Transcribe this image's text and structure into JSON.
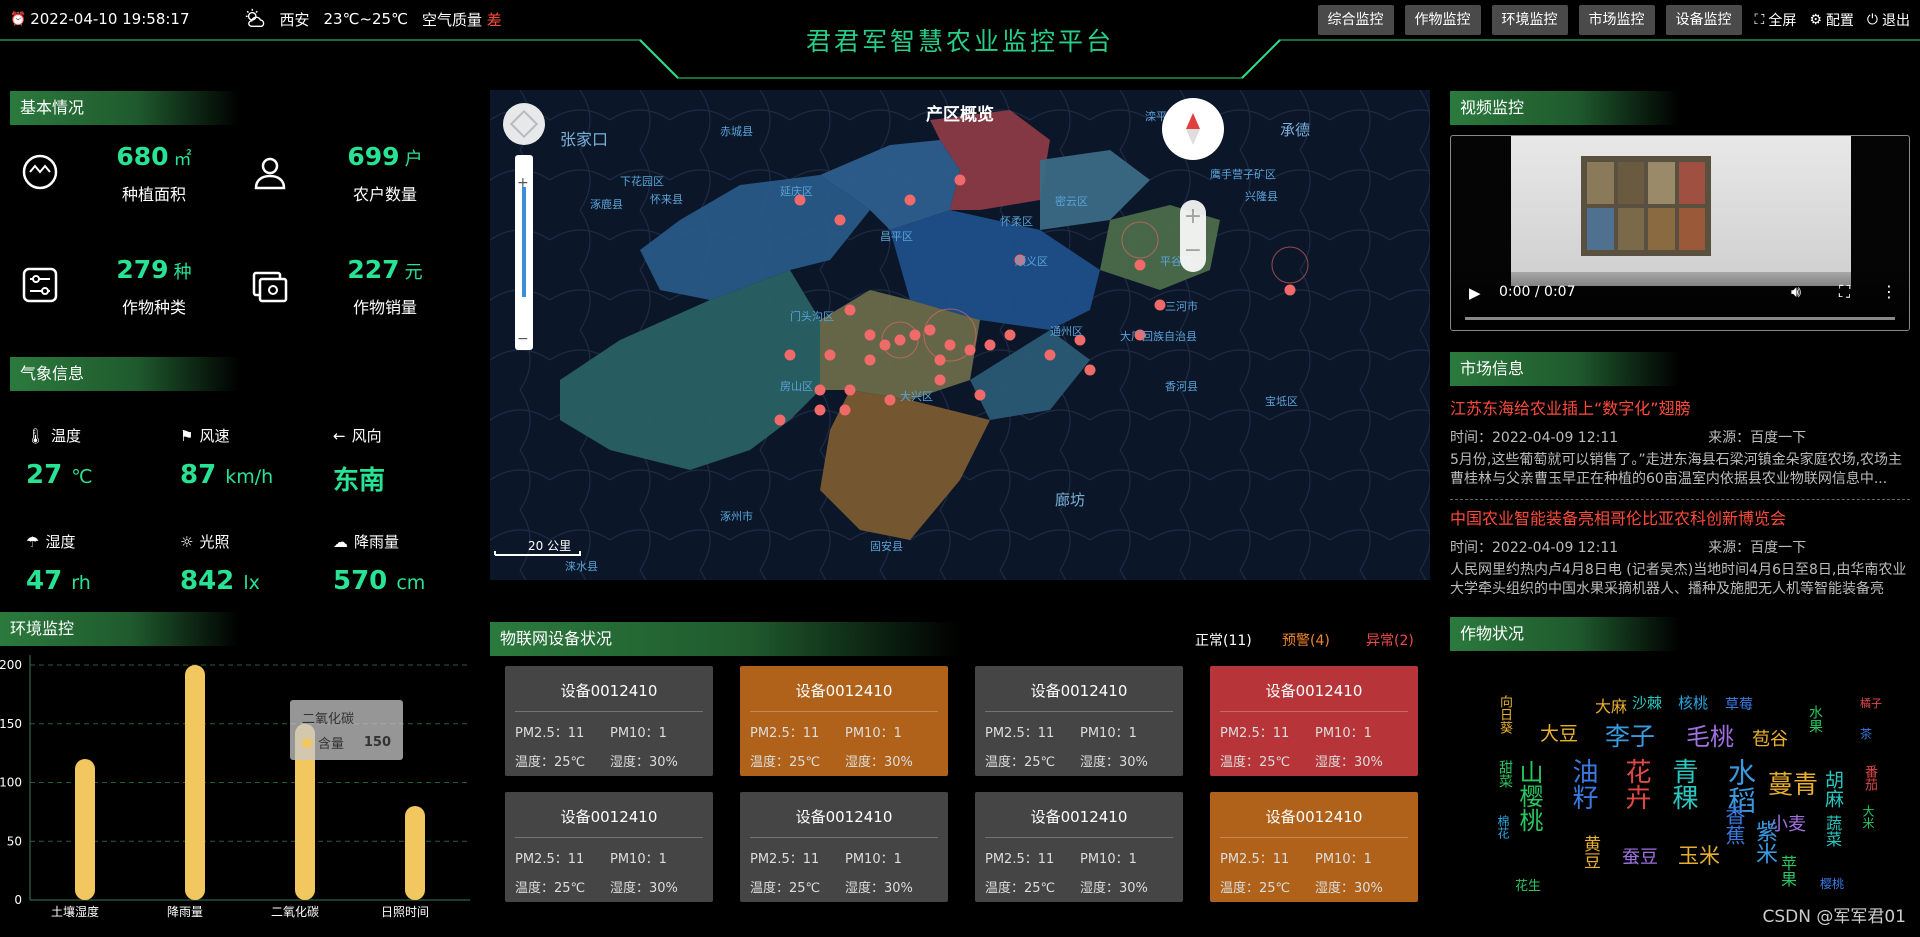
{
  "header": {
    "datetime": "2022-04-10 19:58:17",
    "city": "西安",
    "temp_range": "23℃~25℃",
    "air_label": "空气质量",
    "air_value": "差",
    "title": "君君军智慧农业监控平台",
    "nav": [
      "综合监控",
      "作物监控",
      "环境监控",
      "市场监控",
      "设备监控"
    ],
    "tools": {
      "fullscreen": "全屏",
      "config": "配置",
      "exit": "退出"
    }
  },
  "basic": {
    "title": "基本情况",
    "stats": [
      {
        "value": "680",
        "unit": "㎡",
        "label": "种植面积",
        "icon": "area-icon"
      },
      {
        "value": "699",
        "unit": "户",
        "label": "农户数量",
        "icon": "user-icon"
      },
      {
        "value": "279",
        "unit": "种",
        "label": "作物种类",
        "icon": "settings-icon"
      },
      {
        "value": "227",
        "unit": "元",
        "label": "作物销量",
        "icon": "sales-icon"
      }
    ]
  },
  "weather": {
    "title": "气象信息",
    "items": [
      {
        "label": "温度",
        "value": "27",
        "unit": "℃",
        "icon": "thermometer-icon"
      },
      {
        "label": "风速",
        "value": "87",
        "unit": "km/h",
        "icon": "flag-icon"
      },
      {
        "label": "风向",
        "value": "东南",
        "unit": "",
        "icon": "arrow-left-icon"
      },
      {
        "label": "湿度",
        "value": "47",
        "unit": "rh",
        "icon": "umbrella-icon"
      },
      {
        "label": "光照",
        "value": "842",
        "unit": "lx",
        "icon": "sun-icon"
      },
      {
        "label": "降雨量",
        "value": "570",
        "unit": "cm",
        "icon": "rain-cloud-icon"
      }
    ]
  },
  "env": {
    "title": "环境监控",
    "tooltip": {
      "title": "二氧化碳",
      "label": "含量",
      "value": "150"
    }
  },
  "chart_data": {
    "type": "bar",
    "categories": [
      "土壤湿度",
      "降雨量",
      "二氧化碳",
      "日照时间"
    ],
    "values": [
      120,
      200,
      150,
      80
    ],
    "ylim": [
      0,
      200
    ],
    "yticks": [
      "0",
      "50",
      "100",
      "150",
      "200"
    ],
    "bar_color": "#f3c760"
  },
  "map": {
    "title": "产区概览",
    "scale": "20 公里",
    "labels": [
      "张家口",
      "涿鹿县",
      "怀来县",
      "延庆区",
      "昌平区",
      "怀柔区",
      "密云区",
      "平谷区",
      "顺义区",
      "门头沟区",
      "房山区",
      "大兴区",
      "通州区",
      "三河市",
      "大厂回族自治县",
      "香河县",
      "宝坻区",
      "廊坊",
      "涿州市",
      "固安县",
      "下花园区",
      "赤城县",
      "滦平县",
      "承德",
      "兴隆县",
      "鹰手营子矿区",
      "涞水县"
    ]
  },
  "video": {
    "title": "视频监控",
    "time": "0:00 / 0:07"
  },
  "market": {
    "title": "市场信息",
    "items": [
      {
        "title": "江苏东海给农业插上“数字化”翅膀",
        "time": "时间：2022-04-09 12:11",
        "source": "来源：百度一下",
        "desc": "5月份,这些葡萄就可以销售了。”走进东海县石梁河镇金朵家庭农场,农场主曹桂林与父亲曹玉早正在种植的60亩温室内依据县农业物联网信息中..."
      },
      {
        "title": "中国农业智能装备亮相哥伦比亚农科创新博览会",
        "time": "时间：2022-04-09 12:11",
        "source": "来源：百度一下",
        "desc": "人民网里约热内卢4月8日电 (记者吴杰)当地时间4月6日至8日,由华南农业大学牵头组织的中国水果采摘机器人、播种及施肥无人机等智能装备亮相..."
      }
    ]
  },
  "iot": {
    "title": "物联网设备状况",
    "status": {
      "normal": "正常(11)",
      "warn": "预警(4)",
      "error": "异常(2)"
    },
    "devices": [
      {
        "name": "设备0012410",
        "pm25": "PM2.5：11",
        "pm10": "PM10：1",
        "temp": "温度：25℃",
        "hum": "湿度：30%",
        "state": "normal"
      },
      {
        "name": "设备0012410",
        "pm25": "PM2.5：11",
        "pm10": "PM10：1",
        "temp": "温度：25℃",
        "hum": "湿度：30%",
        "state": "warn"
      },
      {
        "name": "设备0012410",
        "pm25": "PM2.5：11",
        "pm10": "PM10：1",
        "temp": "温度：25℃",
        "hum": "湿度：30%",
        "state": "normal"
      },
      {
        "name": "设备0012410",
        "pm25": "PM2.5：11",
        "pm10": "PM10：1",
        "temp": "温度：25℃",
        "hum": "湿度：30%",
        "state": "error"
      },
      {
        "name": "设备0012410",
        "pm25": "PM2.5：11",
        "pm10": "PM10：1",
        "temp": "温度：25℃",
        "hum": "湿度：30%",
        "state": "normal"
      },
      {
        "name": "设备0012410",
        "pm25": "PM2.5：11",
        "pm10": "PM10：1",
        "temp": "温度：25℃",
        "hum": "湿度：30%",
        "state": "normal"
      },
      {
        "name": "设备0012410",
        "pm25": "PM2.5：11",
        "pm10": "PM10：1",
        "temp": "温度：25℃",
        "hum": "湿度：30%",
        "state": "normal"
      },
      {
        "name": "设备0012410",
        "pm25": "PM2.5：11",
        "pm10": "PM10：1",
        "temp": "温度：25℃",
        "hum": "湿度：30%",
        "state": "warn"
      }
    ]
  },
  "crops": {
    "title": "作物状况",
    "words": [
      "大麻",
      "沙棘",
      "核桃",
      "草莓",
      "大豆",
      "李子",
      "毛桃",
      "苞谷",
      "水果",
      "山樱桃",
      "油籽",
      "花卉",
      "青稞",
      "水稻",
      "蔓青",
      "胡麻",
      "小麦",
      "紫米",
      "玉米",
      "蚕豆",
      "花生",
      "苹果",
      "蔬菜",
      "甜菜",
      "向日葵",
      "香蕉",
      "黄豆",
      "樱桃",
      "茶",
      "橘子",
      "棉花",
      "番茄",
      "大米"
    ]
  },
  "watermark": "CSDN @军军君01"
}
